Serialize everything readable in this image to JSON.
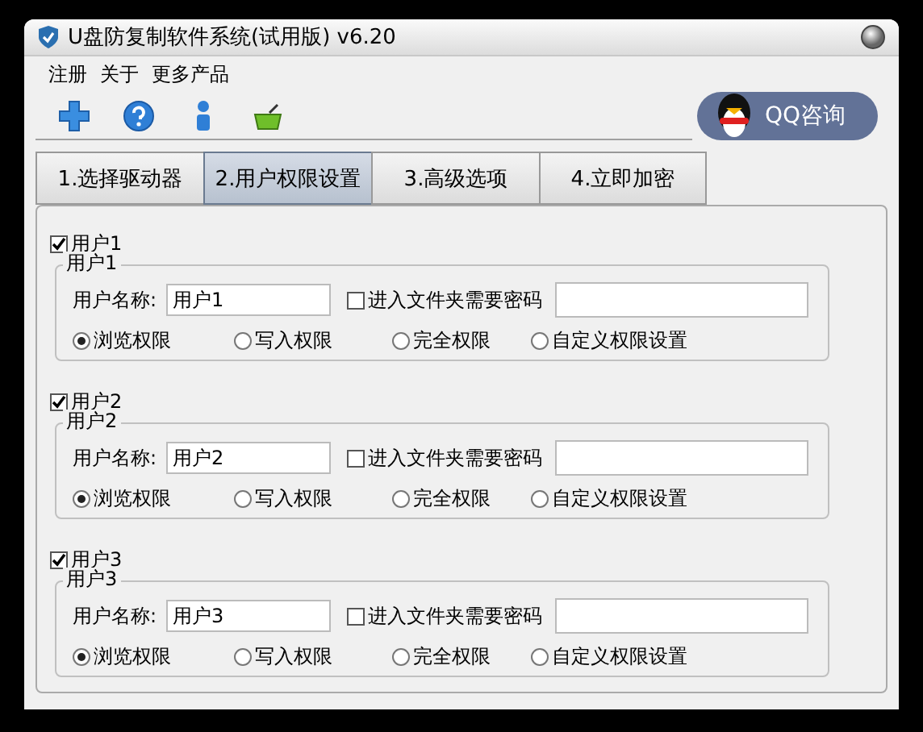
{
  "window": {
    "title": "U盘防复制软件系统(试用版) v6.20"
  },
  "menu": [
    "注册",
    "关于",
    "更多产品"
  ],
  "toolbar": [
    {
      "kind": "plus"
    },
    {
      "kind": "help"
    },
    {
      "kind": "user"
    },
    {
      "kind": "basket"
    }
  ],
  "qq_button": {
    "label": "QQ咨询"
  },
  "tabs": [
    {
      "label": "1.选择驱动器",
      "selected": false
    },
    {
      "label": "2.用户权限设置",
      "selected": true
    },
    {
      "label": "3.高级选项",
      "selected": false
    },
    {
      "label": "4.立即加密",
      "selected": false
    }
  ],
  "users": [
    {
      "enabled_label": "用户1",
      "enabled": true,
      "group_title": "用户1",
      "name_label": "用户名称:",
      "name_value": "用户1",
      "password_label": "进入文件夹需要密码",
      "password_required": false,
      "permissions": [
        {
          "label": "浏览权限",
          "selected": true
        },
        {
          "label": "写入权限",
          "selected": false
        },
        {
          "label": "完全权限",
          "selected": false
        },
        {
          "label": "自定义权限设置",
          "selected": false
        }
      ]
    },
    {
      "enabled_label": "用户2",
      "enabled": true,
      "group_title": "用户2",
      "name_label": "用户名称:",
      "name_value": "用户2",
      "password_label": "进入文件夹需要密码",
      "password_required": false,
      "permissions": [
        {
          "label": "浏览权限",
          "selected": true
        },
        {
          "label": "写入权限",
          "selected": false
        },
        {
          "label": "完全权限",
          "selected": false
        },
        {
          "label": "自定义权限设置",
          "selected": false
        }
      ]
    },
    {
      "enabled_label": "用户3",
      "enabled": true,
      "group_title": "用户3",
      "name_label": "用户名称:",
      "name_value": "用户3",
      "password_label": "进入文件夹需要密码",
      "password_required": false,
      "permissions": [
        {
          "label": "浏览权限",
          "selected": true
        },
        {
          "label": "写入权限",
          "selected": false
        },
        {
          "label": "完全权限",
          "selected": false
        },
        {
          "label": "自定义权限设置",
          "selected": false
        }
      ]
    }
  ]
}
